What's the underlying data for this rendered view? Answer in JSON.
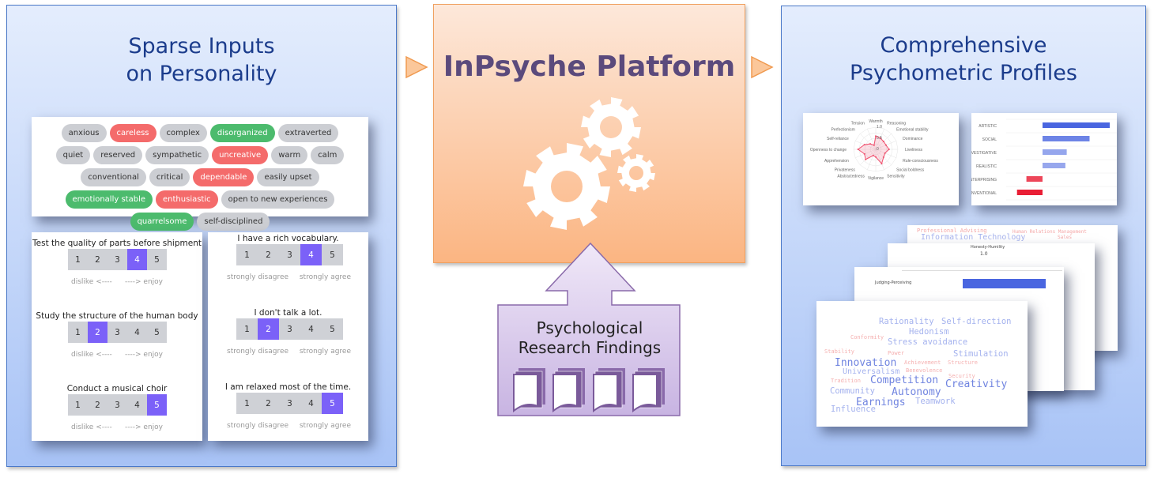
{
  "left": {
    "title_line1": "Sparse Inputs",
    "title_line2": "on Personality",
    "tags": [
      {
        "label": "anxious",
        "state": "neutral"
      },
      {
        "label": "careless",
        "state": "red"
      },
      {
        "label": "complex",
        "state": "neutral"
      },
      {
        "label": "disorganized",
        "state": "green"
      },
      {
        "label": "extraverted",
        "state": "neutral"
      },
      {
        "label": "quiet",
        "state": "neutral"
      },
      {
        "label": "reserved",
        "state": "neutral"
      },
      {
        "label": "sympathetic",
        "state": "neutral"
      },
      {
        "label": "uncreative",
        "state": "red"
      },
      {
        "label": "warm",
        "state": "neutral"
      },
      {
        "label": "calm",
        "state": "neutral"
      },
      {
        "label": "conventional",
        "state": "neutral"
      },
      {
        "label": "critical",
        "state": "neutral"
      },
      {
        "label": "dependable",
        "state": "red"
      },
      {
        "label": "easily upset",
        "state": "neutral"
      },
      {
        "label": "emotionally stable",
        "state": "green"
      },
      {
        "label": "enthusiastic",
        "state": "red"
      },
      {
        "label": "open to new experiences",
        "state": "neutral"
      },
      {
        "label": "quarrelsome",
        "state": "green"
      },
      {
        "label": "self-disciplined",
        "state": "neutral"
      }
    ],
    "interest_items": [
      {
        "question": "Test the quality of parts before shipment",
        "selected": 4
      },
      {
        "question": "Study the structure of the human body",
        "selected": 2
      },
      {
        "question": "Conduct a musical choir",
        "selected": 5
      }
    ],
    "interest_scale": {
      "min_label": "dislike <----",
      "max_label": "----> enjoy",
      "options": [
        "1",
        "2",
        "3",
        "4",
        "5"
      ]
    },
    "agree_items": [
      {
        "question": "I have a rich vocabulary.",
        "selected": 4
      },
      {
        "question": "I don't talk a lot.",
        "selected": 2
      },
      {
        "question": "I am relaxed most of the time.",
        "selected": 5
      }
    ],
    "agree_scale": {
      "min_label": "strongly disagree",
      "max_label": "strongly agree",
      "options": [
        "1",
        "2",
        "3",
        "4",
        "5"
      ]
    }
  },
  "center": {
    "title": "InPsyche Platform",
    "icon": "gears-icon",
    "research_line1": "Psychological",
    "research_line2": "Research Findings",
    "research_icon": "document-stack-icon"
  },
  "right": {
    "title_line1": "Comprehensive",
    "title_line2": "Psychometric Profiles",
    "card_labels": {
      "back_words": [
        "Professional Advising",
        "Human Relations Management",
        "Information Technology",
        "Sales"
      ],
      "radar2_axis": "Honesty-Humility",
      "radar2_tick": "1.0",
      "bar2_label": "Judging-Perceiving"
    },
    "wordcloud": [
      {
        "word": "Rationality",
        "tone": "blue",
        "weight": 3
      },
      {
        "word": "Self-direction",
        "tone": "blue",
        "weight": 3
      },
      {
        "word": "Hedonism",
        "tone": "blue",
        "weight": 3
      },
      {
        "word": "Conformity",
        "tone": "red",
        "weight": 1
      },
      {
        "word": "Stress avoidance",
        "tone": "blue",
        "weight": 3
      },
      {
        "word": "Stability",
        "tone": "red",
        "weight": 1
      },
      {
        "word": "Power",
        "tone": "red",
        "weight": 1
      },
      {
        "word": "Stimulation",
        "tone": "blue",
        "weight": 3
      },
      {
        "word": "Innovation",
        "tone": "blue",
        "weight": 4
      },
      {
        "word": "Achievement",
        "tone": "red",
        "weight": 1
      },
      {
        "word": "Structure",
        "tone": "red",
        "weight": 1
      },
      {
        "word": "Universalism",
        "tone": "blue",
        "weight": 2
      },
      {
        "word": "Benevolence",
        "tone": "red",
        "weight": 1
      },
      {
        "word": "Security",
        "tone": "red",
        "weight": 1
      },
      {
        "word": "Tradition",
        "tone": "red",
        "weight": 1
      },
      {
        "word": "Competition",
        "tone": "blue",
        "weight": 4
      },
      {
        "word": "Creativity",
        "tone": "blue",
        "weight": 4
      },
      {
        "word": "Community",
        "tone": "blue",
        "weight": 3
      },
      {
        "word": "Autonomy",
        "tone": "blue",
        "weight": 4
      },
      {
        "word": "Earnings",
        "tone": "blue",
        "weight": 4
      },
      {
        "word": "Teamwork",
        "tone": "blue",
        "weight": 3
      },
      {
        "word": "Influence",
        "tone": "blue",
        "weight": 3
      }
    ]
  },
  "colors": {
    "tag_red": "#f46b6b",
    "tag_green": "#4cbb6d",
    "selected": "#7b61f8",
    "positive_bar": "#4a66e0",
    "negative_bar": "#e8142c",
    "radar": "#f0506e"
  },
  "chart_data": [
    {
      "type": "radar",
      "rlim": [
        0,
        1
      ],
      "ticks": [
        "1.0",
        "0.5",
        "0"
      ],
      "categories": [
        "Warmth",
        "Reasoning",
        "Emotional stability",
        "Dominance",
        "Liveliness",
        "Rule-consciousness",
        "Social boldness",
        "Sensitivity",
        "Vigilance",
        "Abstractedness",
        "Privateness",
        "Apprehension",
        "Openness to change",
        "Self-reliance",
        "Perfectionism",
        "Tension"
      ],
      "values": [
        0.6,
        0.55,
        0.5,
        0.5,
        0.6,
        0.45,
        0.5,
        0.7,
        0.35,
        0.3,
        0.65,
        0.55,
        0.8,
        0.55,
        0.35,
        0.2
      ]
    },
    {
      "type": "bar",
      "orientation": "horizontal",
      "categories": [
        "ARTISTIC",
        "SOCIAL",
        "INVESTIGATIVE",
        "REALISTIC",
        "ENTERPRISING",
        "CONVENTIONAL"
      ],
      "values": [
        1.0,
        0.7,
        0.36,
        0.34,
        -0.24,
        -0.38
      ]
    }
  ]
}
